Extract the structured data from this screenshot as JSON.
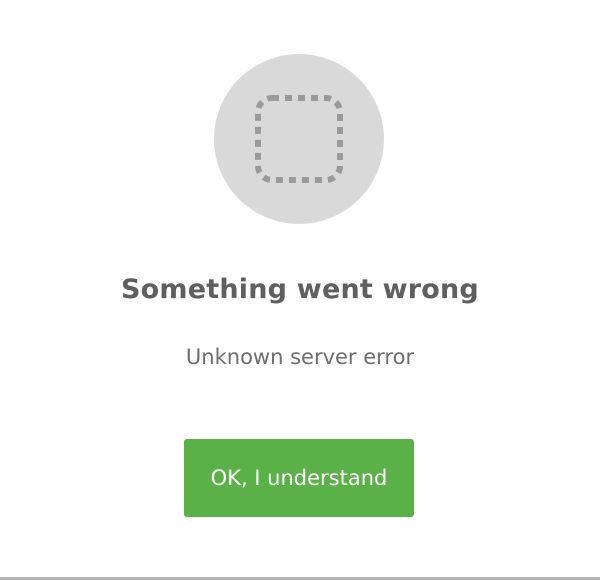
{
  "error_dialog": {
    "icon": "dashed-square-icon",
    "title": "Something went wrong",
    "message": "Unknown server error",
    "confirm_label": "OK, I understand"
  },
  "colors": {
    "icon_circle": "#d9d9d9",
    "icon_dashes": "#9a9a9a",
    "title": "#5f5f5f",
    "message": "#6e6e6e",
    "button": "#5ab147",
    "button_text": "#ffffff"
  }
}
